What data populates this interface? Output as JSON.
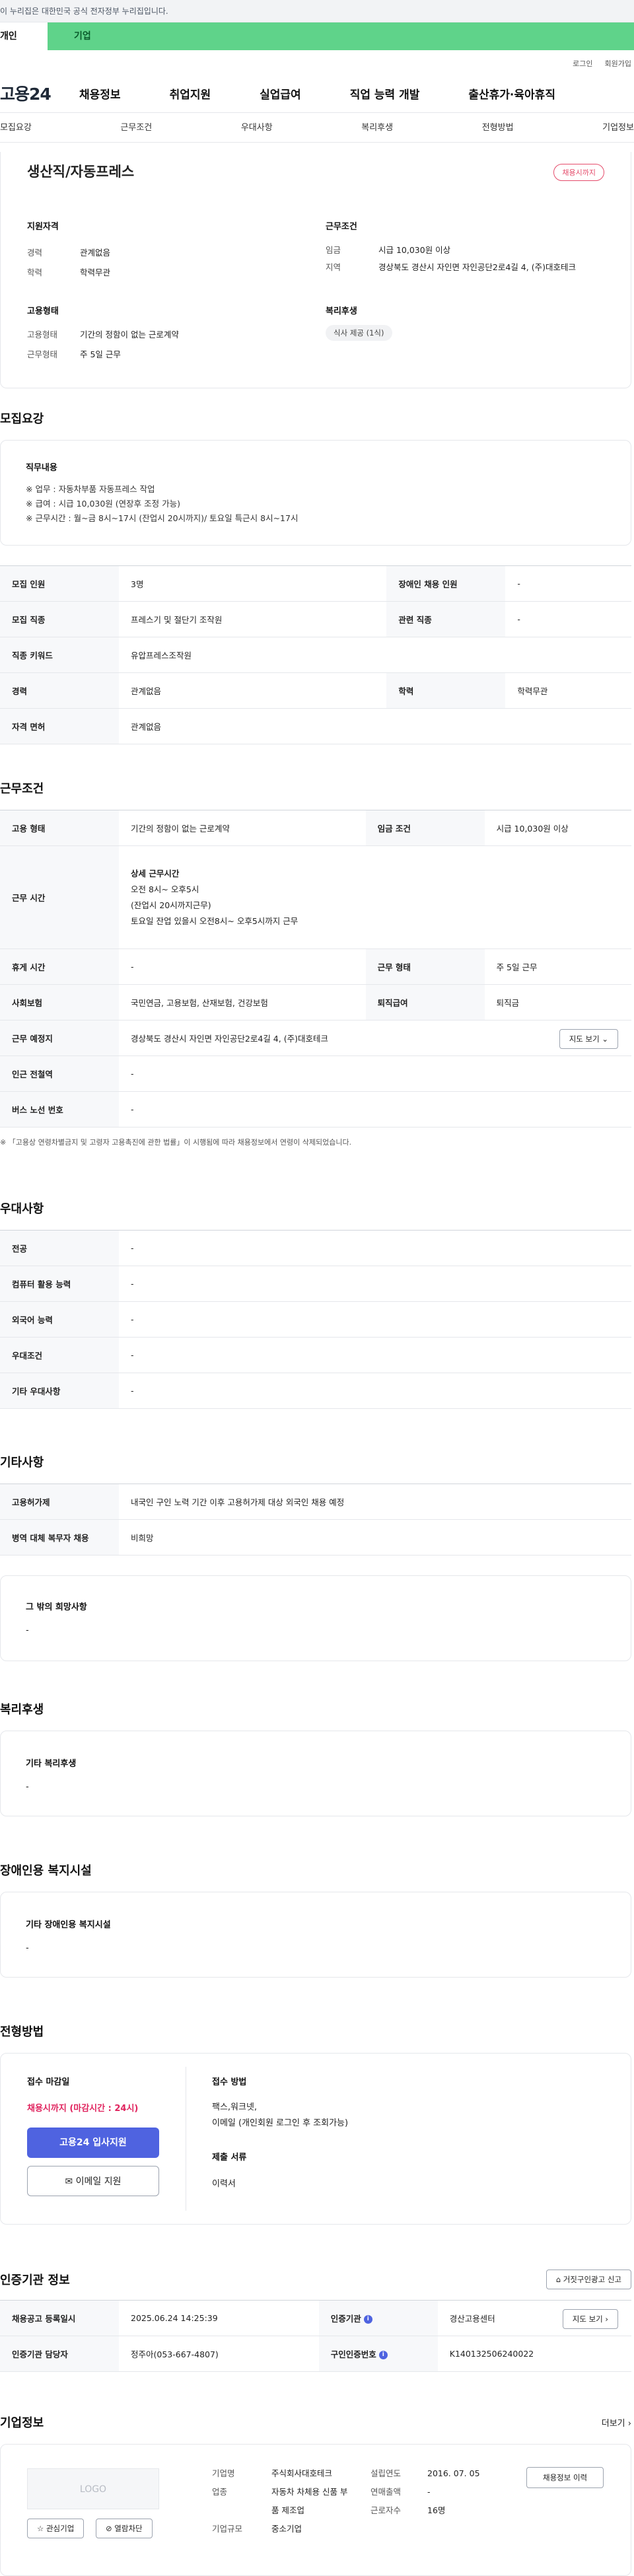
{
  "gov_banner": "이 누리집은 대한민국 공식 전자정부 누리집입니다.",
  "top_tabs": [
    "개인",
    "기업"
  ],
  "util": [
    "로그인",
    "회원가입"
  ],
  "logo": "고용24",
  "gnb": [
    "채용정보",
    "취업지원",
    "실업급여",
    "직업 능력 개발",
    "출산휴가·육아휴직"
  ],
  "subnav": [
    "모집요강",
    "근무조건",
    "우대사항",
    "복리후생",
    "전형방법",
    "기업정보"
  ],
  "summary": {
    "title": "생산직/자동프레스",
    "badge": "채용시까지",
    "qual_title": "지원자격",
    "qual": [
      [
        "경력",
        "관계없음"
      ],
      [
        "학력",
        "학력무관"
      ]
    ],
    "cond_title": "근무조건",
    "cond": [
      [
        "임금",
        "시급 10,030원 이상"
      ],
      [
        "지역",
        "경상북도 경산시 자인면 자인공단2로4길 4, (주)대호테크"
      ]
    ],
    "emp_title": "고용형태",
    "emp": [
      [
        "고용형태",
        "기간의 정함이 없는 근로계약"
      ],
      [
        "근무형태",
        "주 5일 근무"
      ]
    ],
    "welfare_title": "복리후생",
    "welfare_tag": "식사 제공 (1식)"
  },
  "recruit": {
    "heading": "모집요강",
    "duty_title": "직무내용",
    "duty_lines": [
      "※ 업무 : 자동차부품 자동프레스 작업",
      "※ 급여 : 시급 10,030원 (연장후 조정 가능)",
      "※ 근무시간 : 월~금 8시~17시 (잔업시 20시까지)/ 토요일 특근시 8시~17시"
    ],
    "rows": [
      [
        "모집 인원",
        "3명",
        "장애인 채용 인원",
        "-"
      ],
      [
        "모집 직종",
        "프레스기 및 절단기 조작원",
        "관련 직종",
        "-"
      ],
      [
        "직종 키워드",
        "유압프레스조작원",
        "",
        ""
      ],
      [
        "경력",
        "관계없음",
        "학력",
        "학력무관"
      ],
      [
        "자격 면허",
        "관계없음",
        "",
        ""
      ]
    ]
  },
  "work": {
    "heading": "근무조건",
    "emp_type_label": "고용 형태",
    "emp_type": "기간의 정함이 없는 근로계약",
    "wage_label": "임금 조건",
    "wage": "시급 10,030원 이상",
    "time_label": "근무 시간",
    "time_title": "상세 근무시간",
    "time_lines": [
      "오전 8시~ 오후5시",
      "(잔업시 20시까지근무)",
      "토요일 잔업 있을시 오전8시~ 오후5시까지 근무"
    ],
    "rest_label": "휴게 시간",
    "rest": "-",
    "form_label": "근무 형태",
    "form": "주 5일 근무",
    "insurance_label": "사회보험",
    "insurance": "국민연금, 고용보험, 산재보험, 건강보험",
    "severance_label": "퇴직급여",
    "severance": "퇴직금",
    "place_label": "근무 예정지",
    "place": "경상북도 경산시 자인면 자인공단2로4길 4, (주)대호테크",
    "map_btn": "지도 보기",
    "subway_label": "인근 전철역",
    "subway": "-",
    "bus_label": "버스 노선 번호",
    "bus": "-",
    "note": "※ 「고용상 연령차별금지 및 고령자 고용촉진에 관한 법률」이 시행됨에 따라 채용정보에서 연령이 삭제되었습니다."
  },
  "prefer": {
    "heading": "우대사항",
    "rows": [
      [
        "전공",
        "-"
      ],
      [
        "컴퓨터 활용 능력",
        "-"
      ],
      [
        "외국어 능력",
        "-"
      ],
      [
        "우대조건",
        "-"
      ],
      [
        "기타 우대사항",
        "-"
      ]
    ]
  },
  "etc": {
    "heading": "기타사항",
    "rows": [
      [
        "고용허가제",
        "내국인 구인 노력 기간 이후 고용허가제 대상 외국인 채용 예정"
      ],
      [
        "병역 대체 복무자 채용",
        "비희망"
      ]
    ],
    "other_title": "그 밖의 희망사항",
    "other": "-"
  },
  "benefit": {
    "heading": "복리후생",
    "title": "기타 복리후생",
    "value": "-"
  },
  "disability": {
    "heading": "장애인용 복지시설",
    "title": "기타 장애인용 복지시설",
    "value": "-"
  },
  "selection": {
    "heading": "전형방법",
    "deadline_title": "접수 마감일",
    "deadline": "채용시까지 (마감시간 : 24시)",
    "apply_btn": "고용24 입사지원",
    "email_btn": "이메일 지원",
    "method_title": "접수 방법",
    "method_lines": [
      "팩스,워크넷,",
      "이메일 (개인회원 로그인 후 조회가능)"
    ],
    "docs_title": "제출 서류",
    "docs": "이력서"
  },
  "cert": {
    "heading": "인증기관 정보",
    "report_btn": "거짓구인광고 신고",
    "reg_label": "채용공고 등록일시",
    "reg": "2025.06.24 14:25:39",
    "org_label": "인증기관",
    "org": "경산고용센터",
    "map_btn": "지도 보기",
    "staff_label": "인증기관 담당자",
    "staff": "정주아(053-667-4807)",
    "num_label": "구인인증번호",
    "num": "K140132506240022"
  },
  "company": {
    "heading": "기업정보",
    "more": "더보기",
    "logo": "LOGO",
    "fav_btn": "관심기업",
    "block_btn": "열람차단",
    "name_label": "기업명",
    "name": "주식회사대호테크",
    "industry_label": "업종",
    "industry": "자동차 차체용 신품 부품 제조업",
    "size_label": "기업규모",
    "size": "중소기업",
    "year_label": "설립연도",
    "year": "2016. 07. 05",
    "sales_label": "연매출액",
    "sales": "-",
    "staff_label": "근로자수",
    "staff": "16명",
    "hire_btn": "채용정보 이력"
  }
}
